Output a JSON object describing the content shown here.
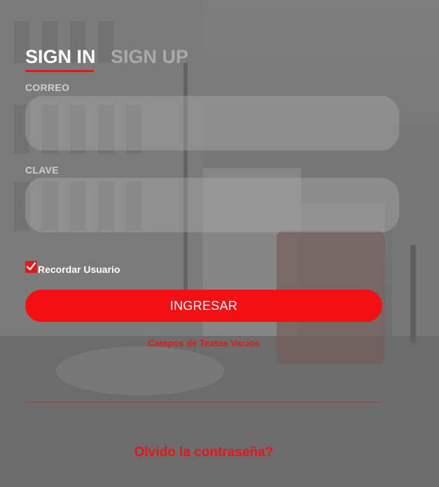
{
  "tabs": {
    "sign_in": "SIGN IN",
    "sign_up": "SIGN UP"
  },
  "form": {
    "email_label": "CORREO",
    "email_value": "",
    "password_label": "CLAVE",
    "password_value": "",
    "remember_label": "Recordar Usuario",
    "remember_checked": true,
    "submit_label": "INGRESAR",
    "error_message": "Campos de Textos Vacios",
    "forgot_label": "Olvido la contraseña?"
  },
  "colors": {
    "accent": "#f71013",
    "active_tab": "#ffffff",
    "inactive_tab": "#a9a9a9"
  },
  "icons": {
    "checkbox": "check-icon"
  }
}
